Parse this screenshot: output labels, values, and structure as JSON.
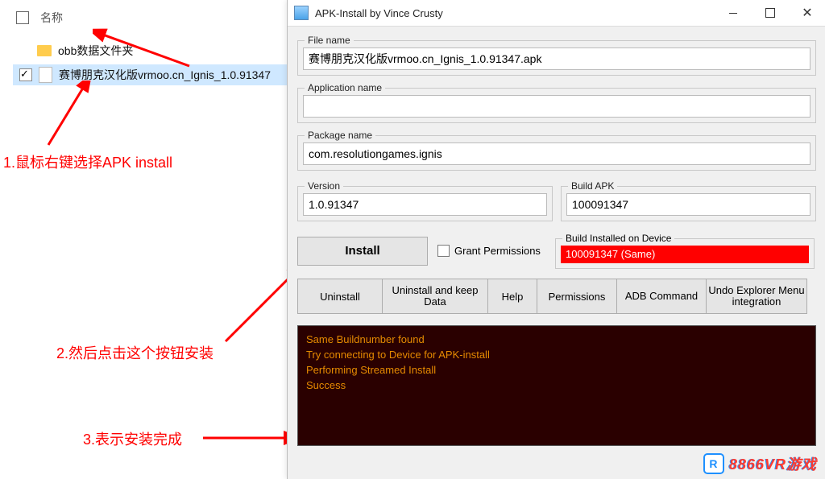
{
  "explorer": {
    "name_header": "名称",
    "items": [
      {
        "label": "obb数据文件夹",
        "checked": false,
        "kind": "folder"
      },
      {
        "label": "赛博朋克汉化版vrmoo.cn_Ignis_1.0.91347",
        "checked": true,
        "kind": "file"
      }
    ]
  },
  "annotations": {
    "a1": "1.鼠标右键选择APK install",
    "a2": "2.然后点击这个按钮安装",
    "a3": "3.表示安装完成"
  },
  "apk_win": {
    "title": "APK-Install by Vince Crusty",
    "file_name_label": "File name",
    "file_name_value": "赛博朋克汉化版vrmoo.cn_Ignis_1.0.91347.apk",
    "app_name_label": "Application name",
    "app_name_value": "",
    "pkg_name_label": "Package name",
    "pkg_name_value": "com.resolutiongames.ignis",
    "version_label": "Version",
    "version_value": "1.0.91347",
    "build_apk_label": "Build APK",
    "build_apk_value": "100091347",
    "install_btn": "Install",
    "grant_label": "Grant Permissions",
    "build_installed_label": "Build Installed on Device",
    "build_installed_value": "100091347 (Same)",
    "buttons": {
      "uninstall": "Uninstall",
      "uninstall_keep": "Uninstall and keep Data",
      "help": "Help",
      "permissions": "Permissions",
      "adb": "ADB Command",
      "undo": "Undo Explorer Menu integration"
    },
    "console_lines": [
      "Same Buildnumber found",
      "",
      "Try connecting to Device for APK-install",
      "Performing Streamed Install",
      "Success"
    ]
  },
  "watermark": "8866VR游戏"
}
